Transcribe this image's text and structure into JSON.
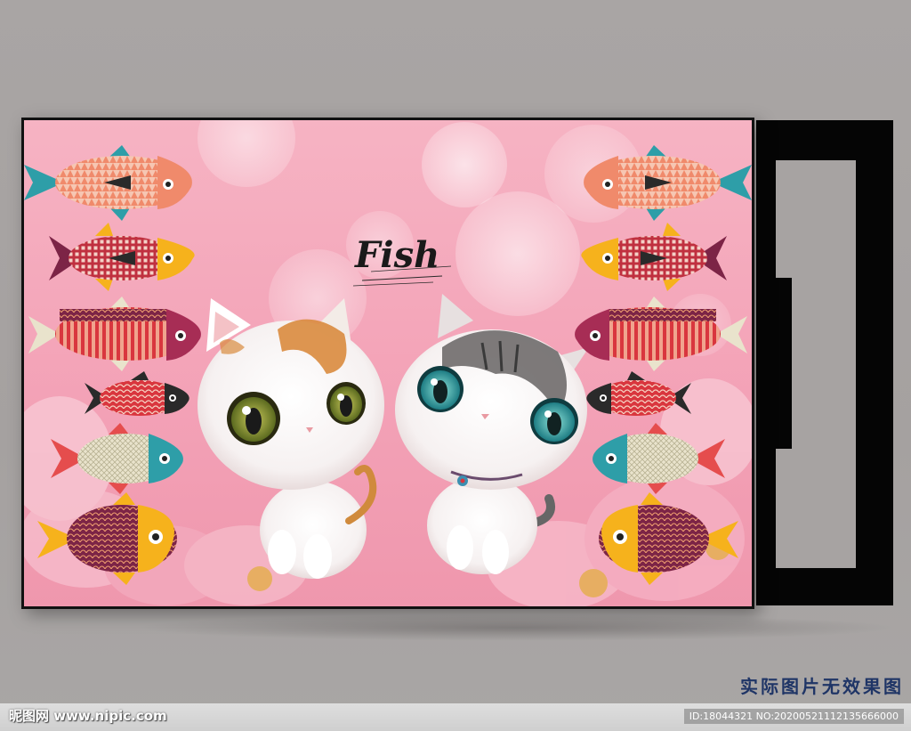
{
  "artwork": {
    "title_text": "Fish",
    "colors": {
      "background_pink": "#f5a9bd",
      "fish_orange": "#f08a6b",
      "fish_teal": "#2e9ea8",
      "fish_yellow": "#f6b21c",
      "fish_red": "#d9363e",
      "fish_maroon": "#7c2446",
      "frame_black": "#050505",
      "wall_gray": "#a8a4a3"
    },
    "fish_icons": [
      "fish-icon-left-1",
      "fish-icon-left-2",
      "fish-icon-left-3",
      "fish-icon-left-4",
      "fish-icon-left-5",
      "fish-icon-left-6",
      "fish-icon-right-1",
      "fish-icon-right-2",
      "fish-icon-right-3",
      "fish-icon-right-4",
      "fish-icon-right-5",
      "fish-icon-right-6"
    ]
  },
  "notice": "实际图片无效果图",
  "footer": {
    "site": "昵图网 www.nipic.com",
    "id_text": "ID:18044321 NO:20200521112135666000"
  }
}
